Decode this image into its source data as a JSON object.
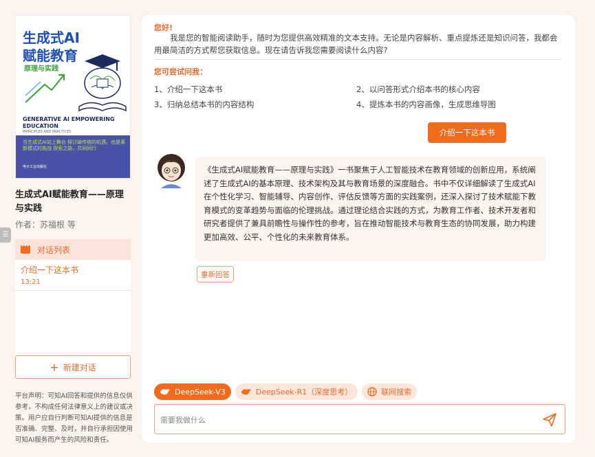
{
  "book": {
    "cover": {
      "title_line1": "生成式AI",
      "title_line2": "赋能教育",
      "subtitle": "原理与实践",
      "english_title": "GENERATIVE AI EMPOWERING EDUCATION",
      "english_sub": "PRINCIPLES AND PRACTICES",
      "blurb": "当生成式AI站上舞台 探讨破传统的机遇，也是革新模式的挑战 探索之路，共同同行",
      "publisher": "电子工业出版社"
    },
    "title": "生成式AI赋能教育——原理与实践",
    "author": "作者：苏福根 等"
  },
  "sidebar": {
    "toggle_label": "☰",
    "conversation_list_label": "对话列表",
    "conversations": [
      {
        "title": "介绍一下这本书",
        "time": "13:21"
      }
    ],
    "new_chat_label": "新建对话",
    "disclaimer": "平台声明：可知AI回答和提供的信息仅供参考，不构成任何法律意义上的建议或决策。用户应自行判断可知AI提供的信息是否准确、完整、及时，并自行承担因使用可知AI服务而产生的风险和责任。"
  },
  "chat": {
    "greeting_hello": "您好!",
    "greeting_text": "我是您的智能阅读助手，随时为您提供高效精准的文本支持。无论是内容解析、重点提炼还是知识问答，我都会用最简洁的方式帮您获取信息。现在请告诉我您需要阅读什么内容?",
    "try_title": "您可尝试问我：",
    "suggestions": [
      "1、介绍一下这本书",
      "2、以问答形式介绍本书的核心内容",
      "3、归纳总结本书的内容结构",
      "4、提炼本书的内容画像，生成思维导图"
    ],
    "user_message": "介绍一下这本书",
    "answer": "《生成式AI赋能教育——原理与实践》一书聚焦于人工智能技术在教育领域的创新应用，系统阐述了生成式AI的基本原理、技术架构及其与教育场景的深度融合。书中不仅详细解读了生成式AI在个性化学习、智能辅导、内容创作、评估反馈等方面的实践案例，还深入探讨了技术赋能下教育模式的变革趋势与面临的伦理挑战。通过理论结合实践的方式，为教育工作者、技术开发者和研究者提供了兼具前瞻性与操作性的参考，旨在推动智能技术与教育生态的协同发展，助力构建更加高效、公平、个性化的未来教育体系。",
    "regenerate_label": "重新回答"
  },
  "models": [
    {
      "label": "DeepSeek-V3",
      "active": true
    },
    {
      "label": "DeepSeek-R1（深度思考）",
      "active": false
    },
    {
      "label": "联网搜索",
      "active": false
    }
  ],
  "input": {
    "placeholder": "需要我做什么"
  },
  "colors": {
    "accent": "#f26b1d",
    "accent_text": "#e96b2e",
    "page_bg": "#fbf3ee",
    "answer_bg": "#fdf4f0"
  }
}
